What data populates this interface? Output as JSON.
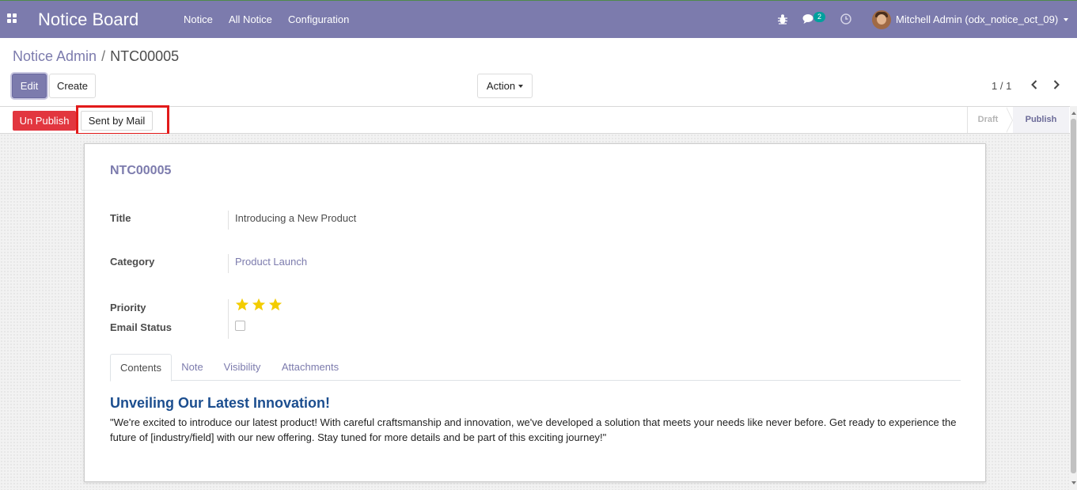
{
  "navbar": {
    "app_title": "Notice Board",
    "menus": [
      "Notice",
      "All Notice",
      "Configuration"
    ],
    "chat_count": "2",
    "user_name": "Mitchell Admin (odx_notice_oct_09)",
    "icons": [
      "apps-grid-icon",
      "bug-icon",
      "chat-icon",
      "clock-icon",
      "avatar"
    ]
  },
  "breadcrumb": {
    "parent": "Notice Admin",
    "separator": "/",
    "current": "NTC00005"
  },
  "toolbar": {
    "edit_label": "Edit",
    "create_label": "Create",
    "action_label": "Action",
    "pager": "1 / 1"
  },
  "statusbar": {
    "unpublish_label": "Un Publish",
    "sent_mail_label": "Sent by Mail",
    "stages": [
      "Draft",
      "Publish"
    ],
    "active_stage": "Publish"
  },
  "record": {
    "name": "NTC00005",
    "fields": {
      "title_label": "Title",
      "title_value": "Introducing a New Product",
      "category_label": "Category",
      "category_value": "Product Launch",
      "priority_label": "Priority",
      "priority_value": 3,
      "email_status_label": "Email Status",
      "email_status_checked": false
    },
    "tabs": [
      "Contents",
      "Note",
      "Visibility",
      "Attachments"
    ],
    "active_tab": "Contents",
    "content_heading": "Unveiling Our Latest Innovation!",
    "content_body": "\"We're excited to introduce our latest product! With careful craftsmanship and innovation, we've developed a solution that meets your needs like never before. Get ready to experience the future of [industry/field] with our new offering. Stay tuned for more details and be part of this exciting journey!\""
  },
  "colors": {
    "brand": "#7c7bad",
    "danger": "#e2363f",
    "highlight": "#e21a1a",
    "star": "#f3cc00",
    "heading": "#1c4e8f"
  }
}
